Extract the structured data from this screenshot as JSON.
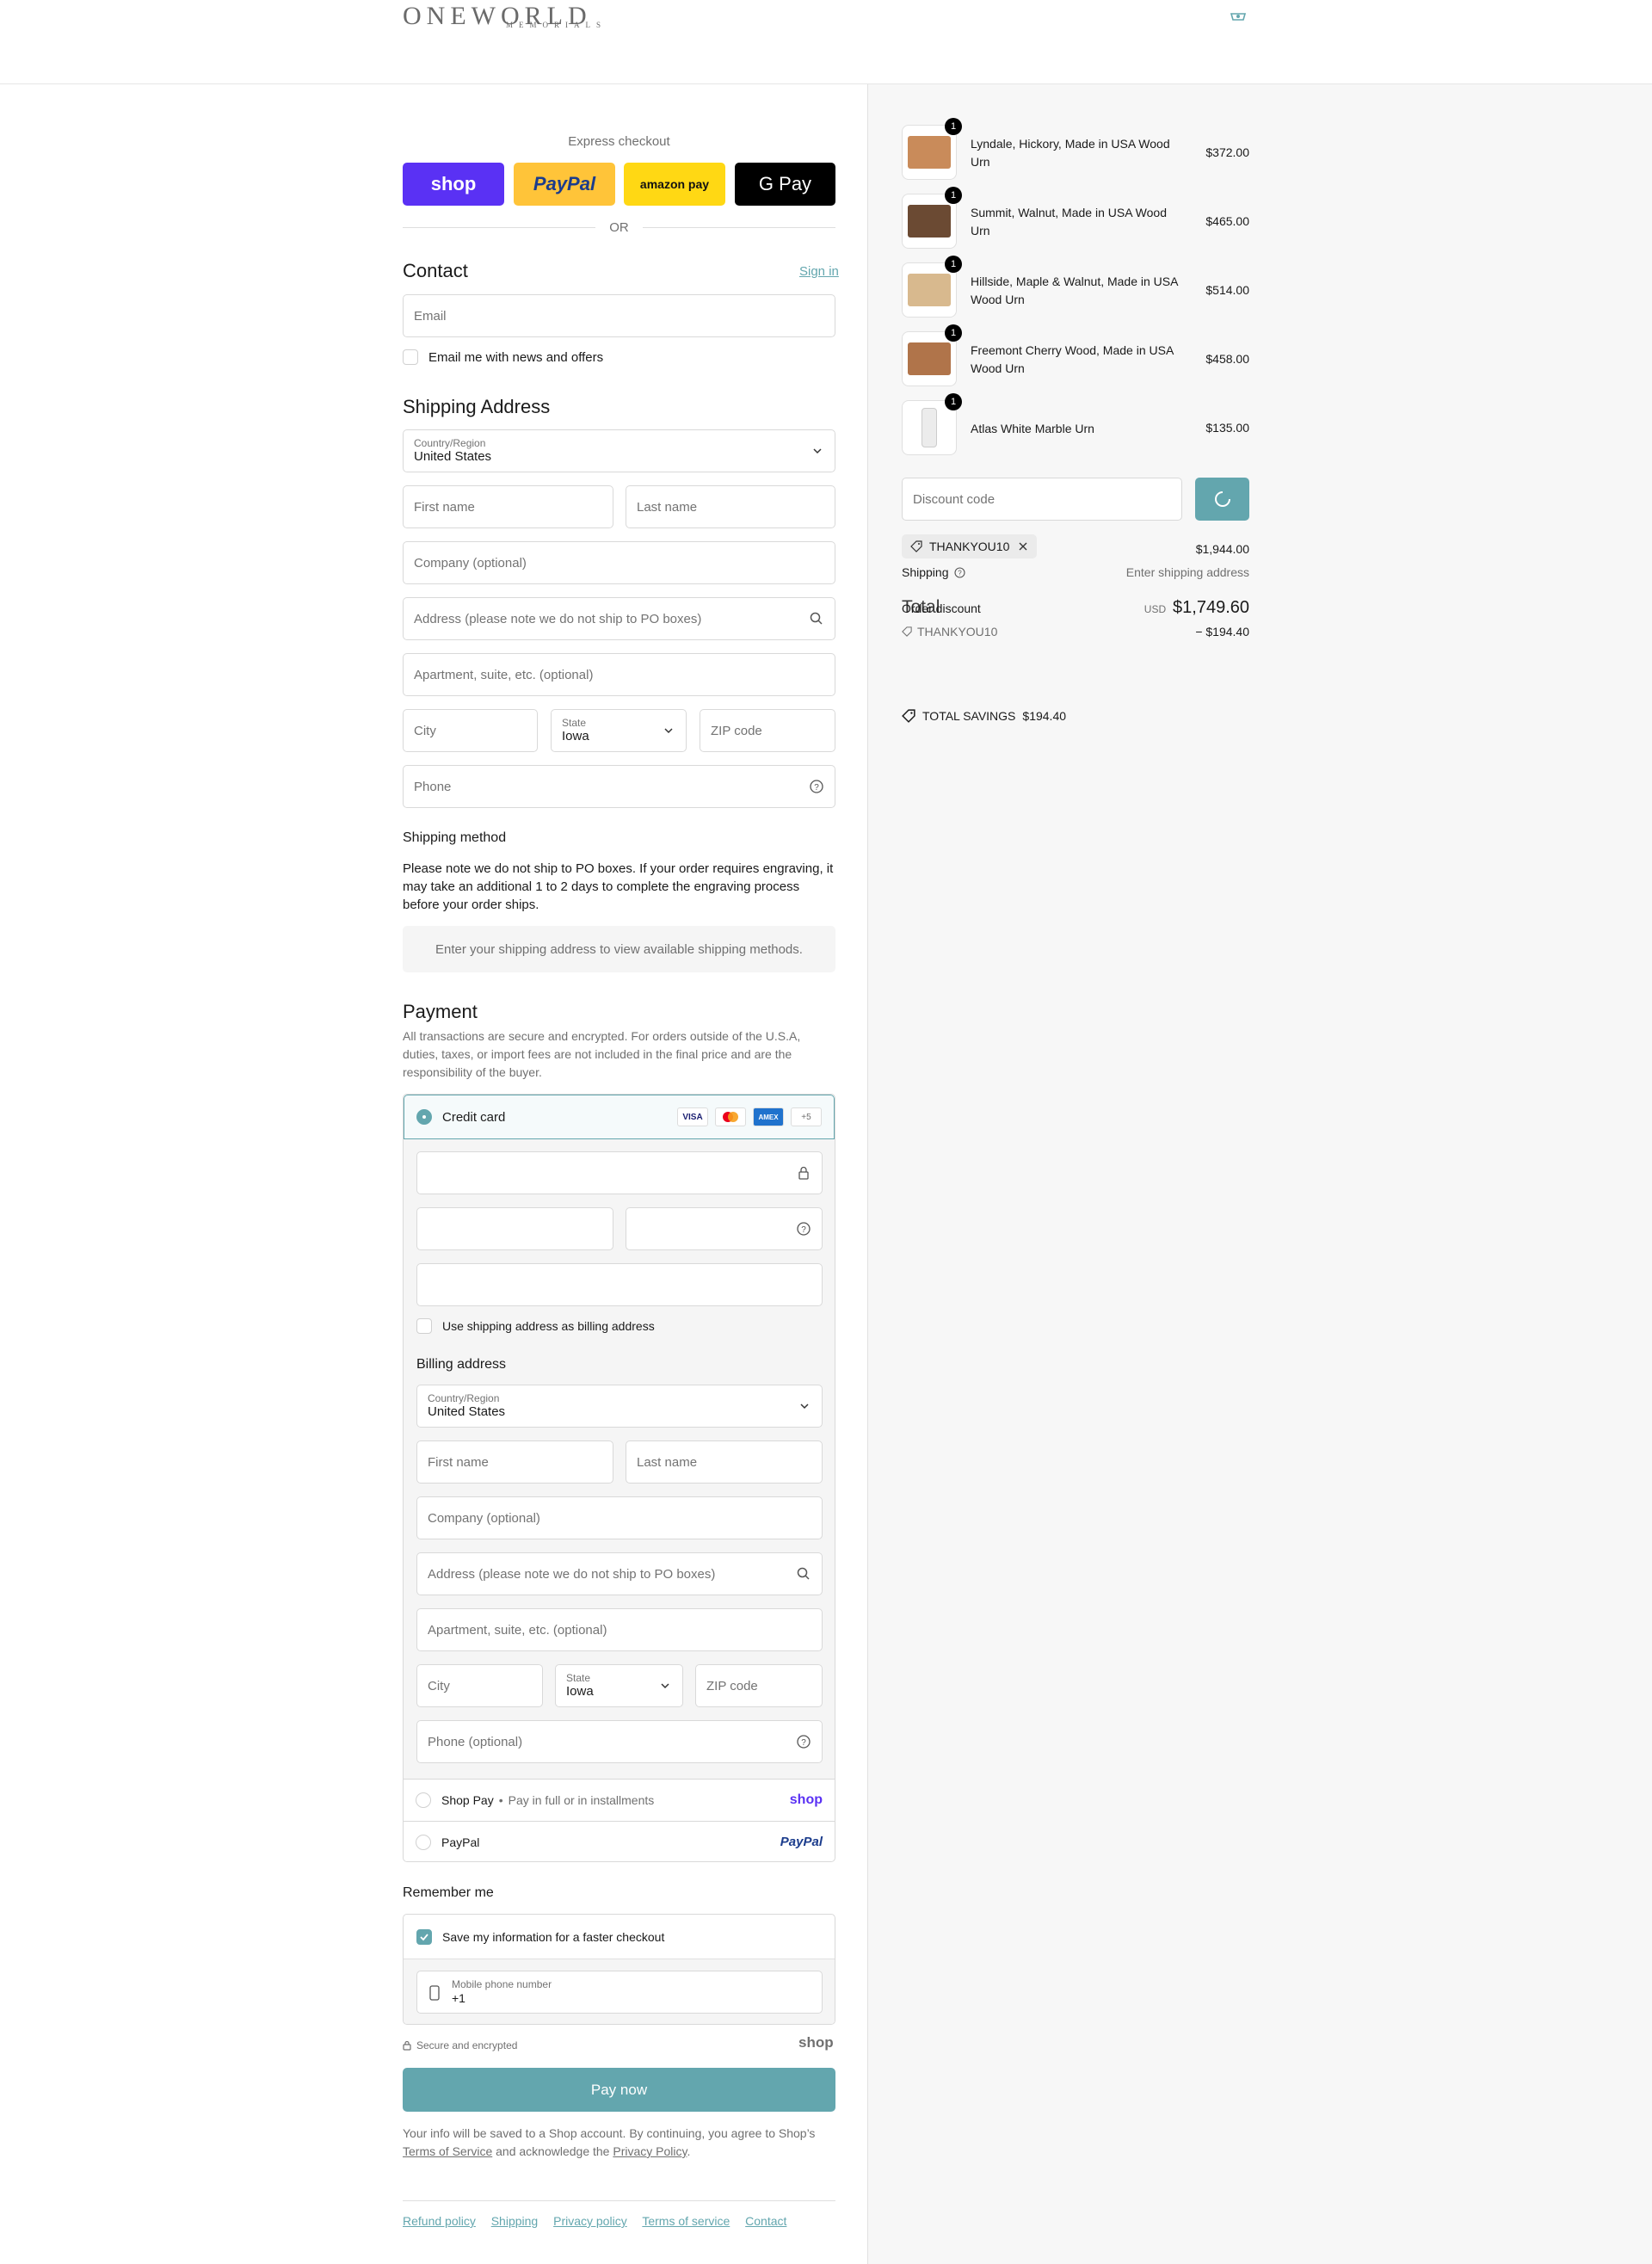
{
  "header": {
    "logo_main": "ONEWORLD",
    "logo_sub": "MEMORIALS"
  },
  "express": {
    "label": "Express checkout",
    "shop_label": "shop",
    "paypal_label": "PayPal",
    "amazon_label": "amazon pay",
    "gpay_label": "G Pay",
    "or_label": "OR"
  },
  "contact": {
    "heading": "Contact",
    "sign_in": "Sign in",
    "email_placeholder": "Email",
    "news_label": "Email me with news and offers"
  },
  "shipping_address": {
    "heading": "Shipping Address",
    "country_label": "Country/Region",
    "country_value": "United States",
    "first_name": "First name",
    "last_name": "Last name",
    "company": "Company (optional)",
    "address": "Address (please note we do not ship to PO boxes)",
    "apartment": "Apartment, suite, etc. (optional)",
    "city": "City",
    "state_label": "State",
    "state_value": "Iowa",
    "zip": "ZIP code",
    "phone": "Phone"
  },
  "shipping_method": {
    "heading": "Shipping method",
    "note": "Please note we do not ship to PO boxes. If your order requires engraving, it may take an additional 1 to 2 days to complete the engraving process before your order ships.",
    "info": "Enter your shipping address to view available shipping methods."
  },
  "payment": {
    "heading": "Payment",
    "note": "All transactions are secure and encrypted. For orders outside of the U.S.A, duties, taxes, or import fees are not included in the final price and are the responsibility of the buyer.",
    "credit_card_label": "Credit card",
    "card_logos": [
      "VISA",
      "MC",
      "AMEX",
      "+5"
    ],
    "use_shipping_label": "Use shipping address as billing address",
    "billing_heading": "Billing address",
    "billing": {
      "country_label": "Country/Region",
      "country_value": "United States",
      "first_name": "First name",
      "last_name": "Last name",
      "company": "Company (optional)",
      "address": "Address (please note we do not ship to PO boxes)",
      "apartment": "Apartment, suite, etc. (optional)",
      "city": "City",
      "state_label": "State",
      "state_value": "Iowa",
      "zip": "ZIP code",
      "phone": "Phone (optional)"
    },
    "shop_pay_label": "Shop Pay",
    "shop_pay_sub": "Pay in full or in installments",
    "shop_pay_logo": "shop",
    "paypal_label": "PayPal",
    "paypal_logo": "PayPal"
  },
  "remember": {
    "heading": "Remember me",
    "save_label": "Save my information for a faster checkout",
    "mobile_label": "Mobile phone number",
    "mobile_value": "+1",
    "secure_label": "Secure and encrypted",
    "shop_logo": "shop"
  },
  "pay_now": "Pay now",
  "consent": {
    "text_before": "Your info will be saved to a Shop account. By continuing, you agree to Shop’s",
    "tos": "Terms of Service",
    "middle": "and acknowledge the",
    "privacy": "Privacy Policy",
    "end": "."
  },
  "footer": {
    "links": [
      "Refund policy",
      "Shipping",
      "Privacy policy",
      "Terms of service",
      "Contact"
    ]
  },
  "cart": {
    "items": [
      {
        "name": "Lyndale, Hickory, Made in USA Wood Urn",
        "price": "$372.00",
        "qty": "1",
        "color": "#c98b5a"
      },
      {
        "name": "Summit, Walnut, Made in USA Wood Urn",
        "price": "$465.00",
        "qty": "1",
        "color": "#6b4a33"
      },
      {
        "name": "Hillside, Maple & Walnut, Made in USA Wood Urn",
        "price": "$514.00",
        "qty": "1",
        "color": "#d8b98e"
      },
      {
        "name": "Freemont Cherry Wood, Made in USA Wood Urn",
        "price": "$458.00",
        "qty": "1",
        "color": "#b0744a"
      },
      {
        "name": "Atlas White Marble Urn",
        "price": "$135.00",
        "qty": "1",
        "color": "#ececec"
      }
    ],
    "discount_placeholder": "Discount code",
    "applied_code": "THANKYOU10",
    "subtotal": "$1,944.00",
    "shipping_label": "Shipping",
    "shipping_value": "Enter shipping address",
    "order_discount_label": "Order discount",
    "total_label": "Total",
    "currency": "USD",
    "total_value": "$1,749.60",
    "discount_code_line": "THANKYOU10",
    "discount_value": "− $194.40",
    "savings_label": "TOTAL SAVINGS",
    "savings_value": "$194.40"
  },
  "colors": {
    "accent": "#63a6ae",
    "shop_purple": "#5a31f4",
    "paypal_yellow": "#ffc439",
    "amazon_yellow": "#ffd814"
  }
}
